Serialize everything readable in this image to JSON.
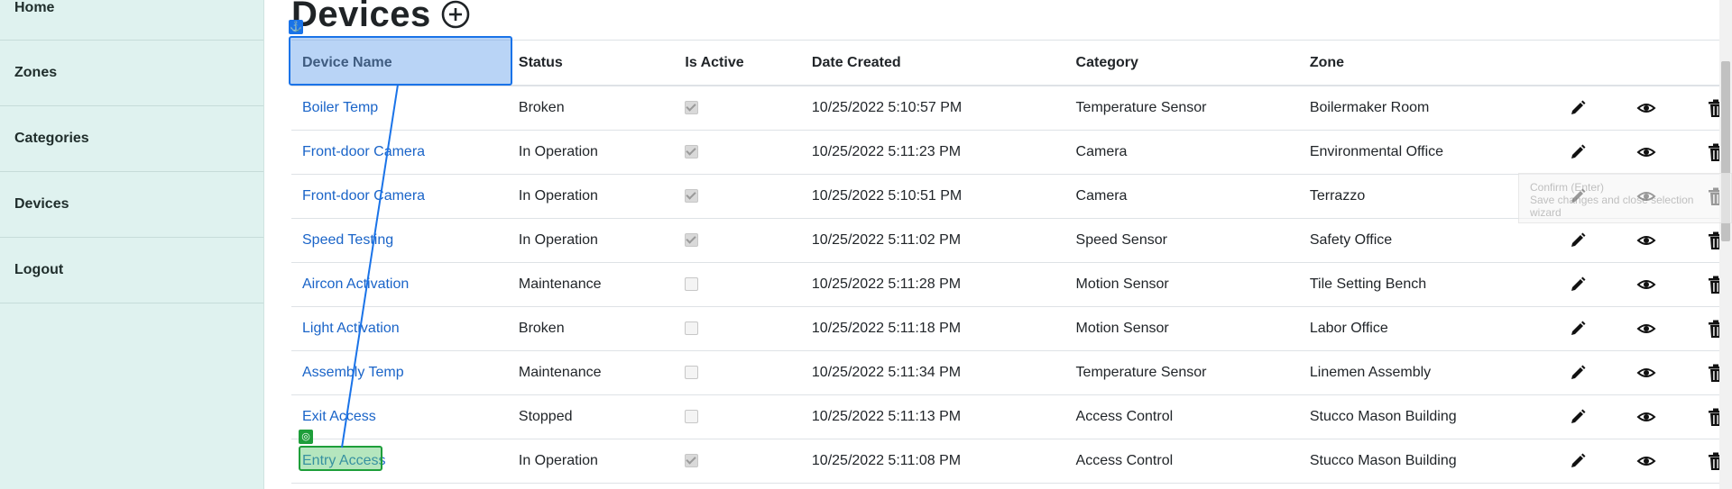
{
  "sidebar": {
    "items": [
      {
        "label": "Home"
      },
      {
        "label": "Zones"
      },
      {
        "label": "Categories"
      },
      {
        "label": "Devices"
      },
      {
        "label": "Logout"
      }
    ]
  },
  "page": {
    "title": "Devices"
  },
  "table": {
    "headers": [
      "Device Name",
      "Status",
      "Is Active",
      "Date Created",
      "Category",
      "Zone"
    ],
    "rows": [
      {
        "name": "Boiler Temp",
        "status": "Broken",
        "active": true,
        "date": "10/25/2022 5:10:57 PM",
        "category": "Temperature Sensor",
        "zone": "Boilermaker Room"
      },
      {
        "name": "Front-door Camera",
        "status": "In Operation",
        "active": true,
        "date": "10/25/2022 5:11:23 PM",
        "category": "Camera",
        "zone": "Environmental Office"
      },
      {
        "name": "Front-door Camera",
        "status": "In Operation",
        "active": true,
        "date": "10/25/2022 5:10:51 PM",
        "category": "Camera",
        "zone": "Terrazzo"
      },
      {
        "name": "Speed Testing",
        "status": "In Operation",
        "active": true,
        "date": "10/25/2022 5:11:02 PM",
        "category": "Speed Sensor",
        "zone": "Safety Office"
      },
      {
        "name": "Aircon Activation",
        "status": "Maintenance",
        "active": false,
        "date": "10/25/2022 5:11:28 PM",
        "category": "Motion Sensor",
        "zone": "Tile Setting Bench"
      },
      {
        "name": "Light Activation",
        "status": "Broken",
        "active": false,
        "date": "10/25/2022 5:11:18 PM",
        "category": "Motion Sensor",
        "zone": "Labor Office"
      },
      {
        "name": "Assembly Temp",
        "status": "Maintenance",
        "active": false,
        "date": "10/25/2022 5:11:34 PM",
        "category": "Temperature Sensor",
        "zone": "Linemen Assembly"
      },
      {
        "name": "Exit Access",
        "status": "Stopped",
        "active": false,
        "date": "10/25/2022 5:11:13 PM",
        "category": "Access Control",
        "zone": "Stucco Mason Building"
      },
      {
        "name": "Entry Access",
        "status": "In Operation",
        "active": true,
        "date": "10/25/2022 5:11:08 PM",
        "category": "Access Control",
        "zone": "Stucco Mason Building"
      }
    ]
  },
  "icons": {
    "add": "plus-circle-icon",
    "edit": "pencil-icon",
    "view": "eye-icon",
    "delete": "trash-icon"
  },
  "colors": {
    "sidebar_bg": "#dff2ef",
    "link": "#1a64c8",
    "drag_source": "#1a73e8",
    "drag_target": "#1e9e3a"
  },
  "ghost_tooltip": {
    "line1": "Confirm (Enter)",
    "line2": "Save changes and close selection wizard"
  }
}
